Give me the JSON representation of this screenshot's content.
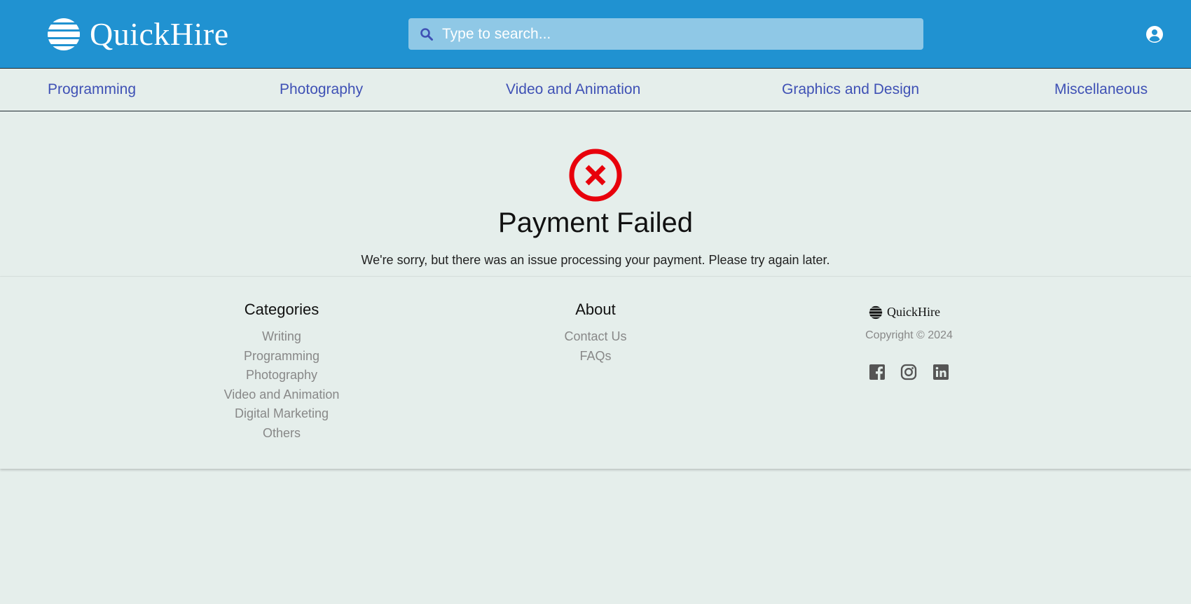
{
  "header": {
    "brand": "QuickHire",
    "search_placeholder": "Type to search...",
    "account_icon": "account-circle-icon",
    "logo_icon": "striped-globe-icon",
    "colors": {
      "bar": "#2092d1",
      "search_bg": "#8fc8e6"
    }
  },
  "nav": {
    "items": [
      "Programming",
      "Photography",
      "Video and Animation",
      "Graphics and Design",
      "Miscellaneous"
    ],
    "link_color": "#3f51b5"
  },
  "status": {
    "icon": "error-circle-x-icon",
    "icon_color": "#e8000b",
    "title": "Payment Failed",
    "message": "We're sorry, but there was an issue processing your payment. Please try again later."
  },
  "footer": {
    "categories": {
      "heading": "Categories",
      "links": [
        "Writing",
        "Programming",
        "Photography",
        "Video and Animation",
        "Digital Marketing",
        "Others"
      ]
    },
    "about": {
      "heading": "About",
      "links": [
        "Contact Us",
        "FAQs"
      ]
    },
    "brand": "QuickHire",
    "copyright": "Copyright © 2024",
    "social": [
      "facebook-icon",
      "instagram-icon",
      "linkedin-icon"
    ]
  }
}
